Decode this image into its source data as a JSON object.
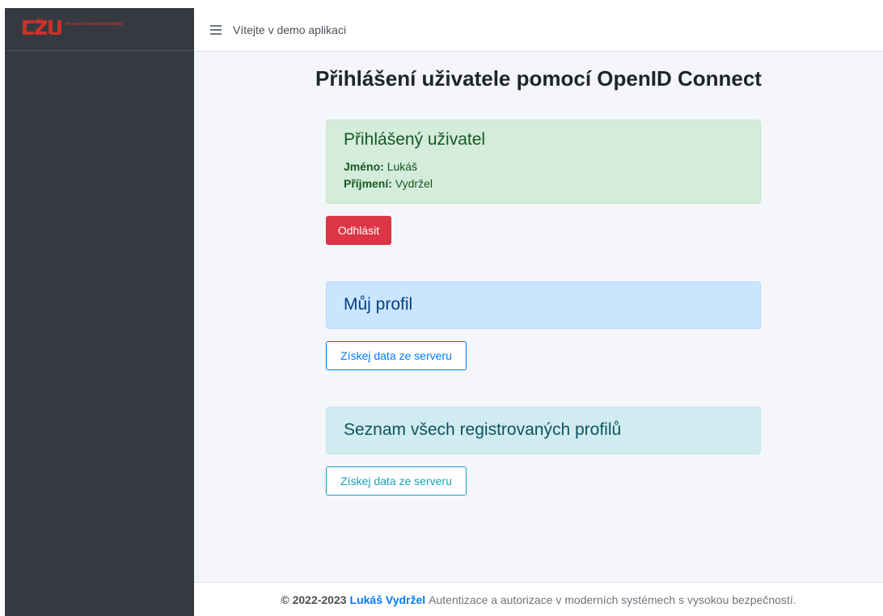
{
  "sidebar": {
    "logo": {
      "mark": "CZU",
      "text": "Provozně ekonomická fakulta"
    }
  },
  "topbar": {
    "menu_icon": "hamburger-icon",
    "title": "Vítejte v demo aplikaci"
  },
  "main": {
    "page_title": "Přihlášení uživatele pomocí OpenID Connect",
    "logged_user": {
      "heading": "Přihlášený uživatel",
      "first_name_label": "Jméno:",
      "first_name_value": "Lukáš",
      "last_name_label": "Příjmení:",
      "last_name_value": "Vydržel"
    },
    "logout_button": "Odhlásit",
    "my_profile": {
      "heading": "Můj profil",
      "button": "Získej data ze serveru"
    },
    "all_profiles": {
      "heading": "Seznam všech registrovaných profilů",
      "button": "Získej data ze serveru"
    }
  },
  "footer": {
    "copyright": "© 2022-2023",
    "author": "Lukáš Vydržel",
    "text": "Autentizace a autorizace v moderních systémech s vysokou bezpečností."
  },
  "colors": {
    "sidebar_bg": "#343a40",
    "danger": "#dc3545",
    "primary": "#007bff",
    "info": "#17a2b8",
    "logo_red": "#c9302c"
  }
}
